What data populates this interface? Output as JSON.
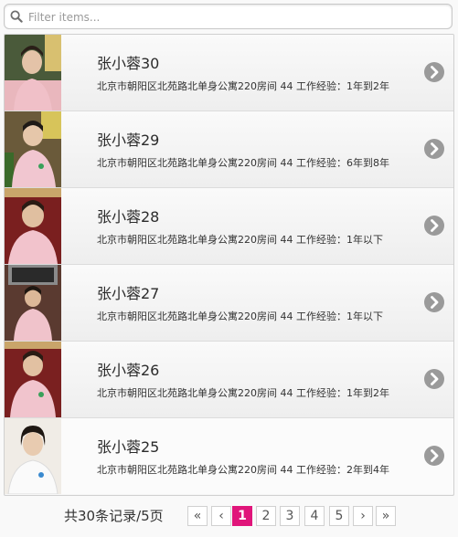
{
  "filter": {
    "placeholder": "Filter items..."
  },
  "items": [
    {
      "name": "张小蓉30",
      "desc": "北京市朝阳区北苑路北单身公寓220房间 44 工作经验：1年到2年"
    },
    {
      "name": "张小蓉29",
      "desc": "北京市朝阳区北苑路北单身公寓220房间 44 工作经验：6年到8年"
    },
    {
      "name": "张小蓉28",
      "desc": "北京市朝阳区北苑路北单身公寓220房间 44 工作经验：1年以下"
    },
    {
      "name": "张小蓉27",
      "desc": "北京市朝阳区北苑路北单身公寓220房间 44 工作经验：1年以下"
    },
    {
      "name": "张小蓉26",
      "desc": "北京市朝阳区北苑路北单身公寓220房间 44 工作经验：1年到2年"
    },
    {
      "name": "张小蓉25",
      "desc": "北京市朝阳区北苑路北单身公寓220房间 44 工作经验：2年到4年"
    }
  ],
  "pagination": {
    "summary": "共30条记录/5页",
    "first": "«",
    "prev": "‹",
    "pages": [
      "1",
      "2",
      "3",
      "4",
      "5"
    ],
    "next": "›",
    "last": "»",
    "current": "1"
  },
  "colors": {
    "accent": "#e0157a"
  }
}
